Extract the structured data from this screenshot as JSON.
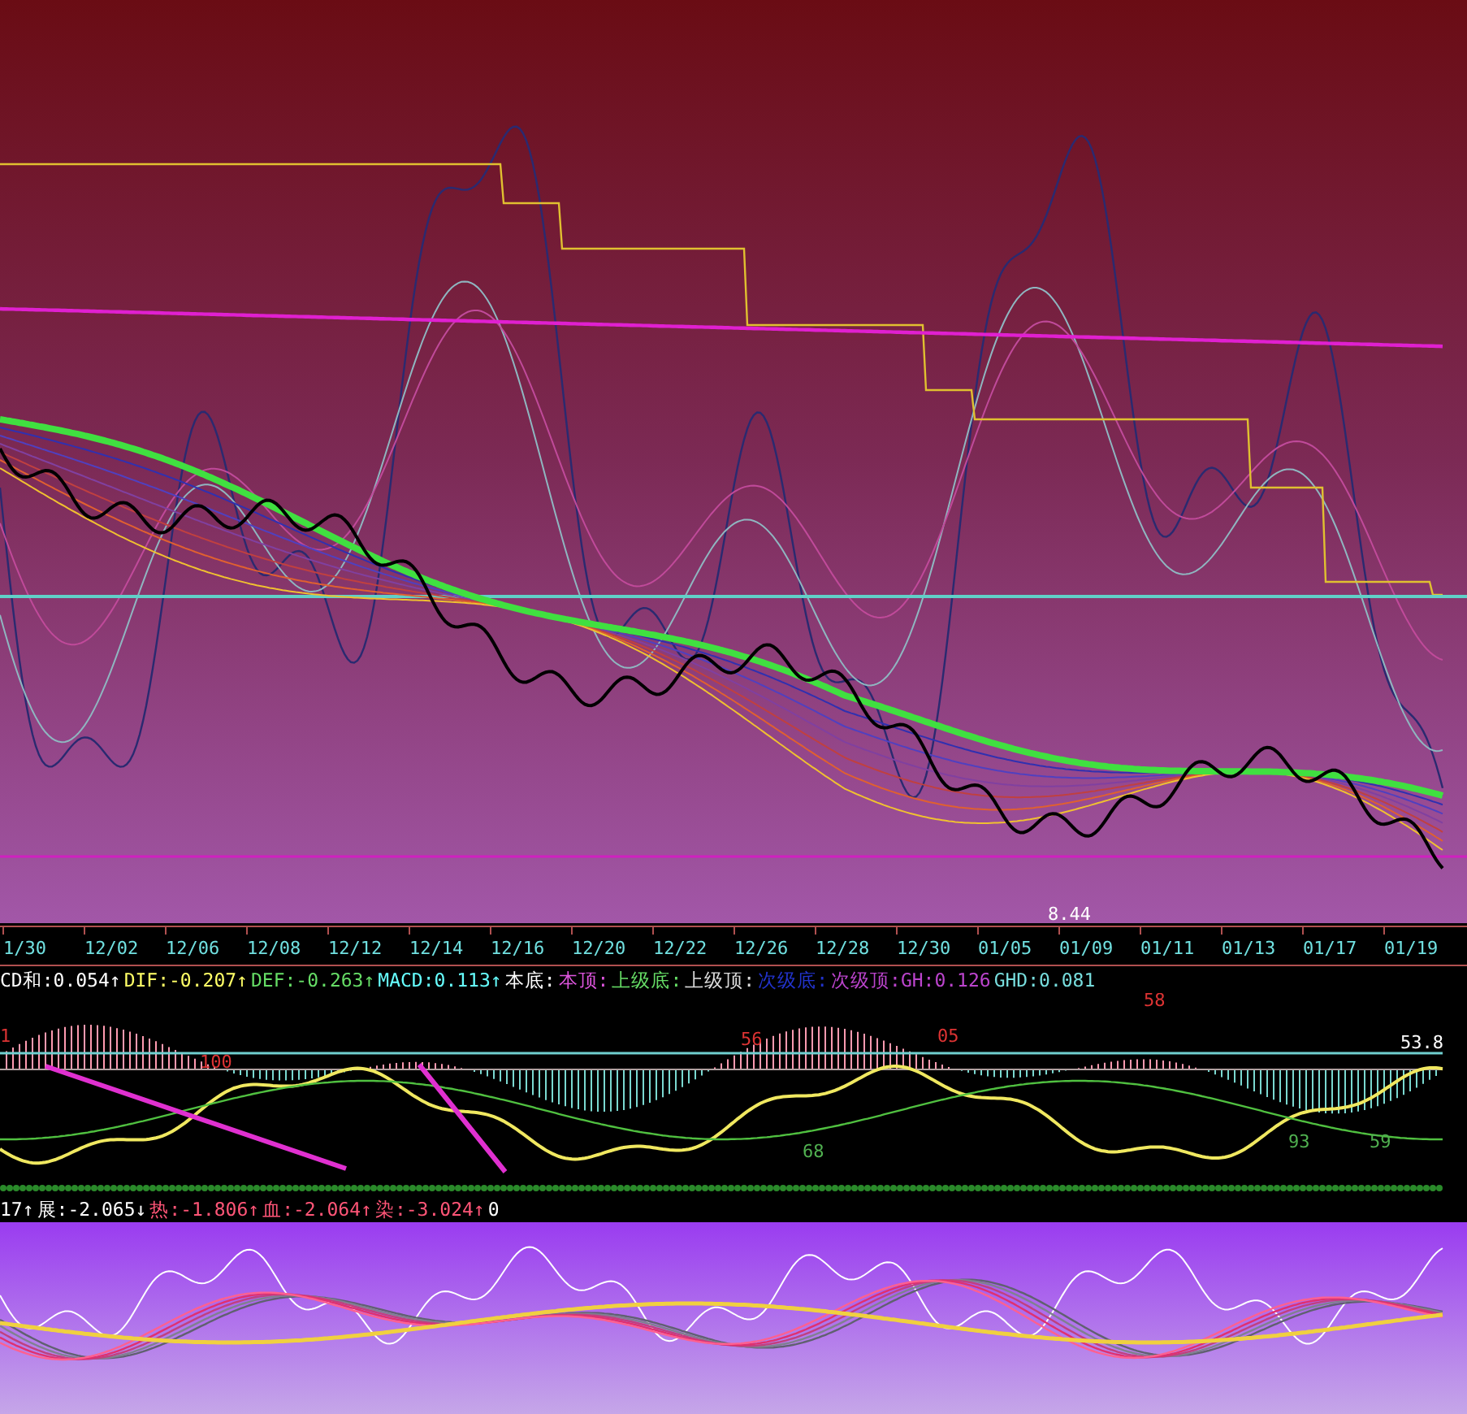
{
  "main_chart": {
    "price_label": "8.44"
  },
  "date_axis": {
    "labels": [
      "1/30",
      "12/02",
      "12/06",
      "12/08",
      "12/12",
      "12/14",
      "12/16",
      "12/20",
      "12/22",
      "12/26",
      "12/28",
      "12/30",
      "01/05",
      "01/09",
      "01/11",
      "01/13",
      "01/17",
      "01/19"
    ]
  },
  "macd_legend": [
    {
      "text": "CD和:0.054↑",
      "color": "#ffffff"
    },
    {
      "text": "DIF:-0.207↑",
      "color": "#ffff66"
    },
    {
      "text": "DEF:-0.263↑",
      "color": "#66dd66"
    },
    {
      "text": "MACD:0.113↑",
      "color": "#66ffff"
    },
    {
      "text": "本底:",
      "color": "#ffffff"
    },
    {
      "text": "本顶:",
      "color": "#dd55dd"
    },
    {
      "text": "上级底:",
      "color": "#66dd66"
    },
    {
      "text": "上级顶:",
      "color": "#dddddd"
    },
    {
      "text": "次级底:",
      "color": "#2233cc"
    },
    {
      "text": "次级顶:GH:0.126",
      "color": "#bb44cc"
    },
    {
      "text": "GHD:0.081",
      "color": "#77dddd"
    }
  ],
  "macd_chart": {
    "labels": [
      "1",
      "100",
      "56",
      "05",
      "58",
      "53.8",
      "68",
      "93",
      "59"
    ]
  },
  "heat_legend": [
    {
      "text": "17↑",
      "color": "#ffffff"
    },
    {
      "text": "展:-2.065↓",
      "color": "#ffffff"
    },
    {
      "text": "热:-1.806↑",
      "color": "#ff5577"
    },
    {
      "text": "血:-2.064↑",
      "color": "#ff5577"
    },
    {
      "text": "染:-3.024↑",
      "color": "#ff5577"
    },
    {
      "text": "0",
      "color": "#ffffff"
    }
  ]
}
